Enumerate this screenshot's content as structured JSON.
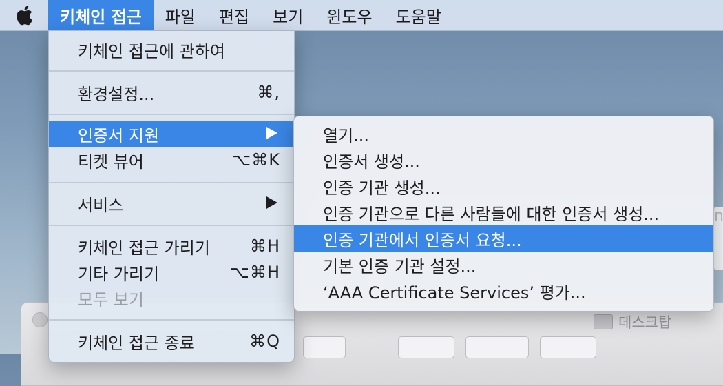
{
  "menubar": {
    "apple_icon": "apple-icon",
    "items": [
      {
        "label": "키체인 접근"
      },
      {
        "label": "파일"
      },
      {
        "label": "편집"
      },
      {
        "label": "보기"
      },
      {
        "label": "윈도우"
      },
      {
        "label": "도움말"
      }
    ]
  },
  "app_menu": {
    "items": [
      {
        "label": "키체인 접근에 관하여",
        "shortcut": ""
      },
      {
        "label": "환경설정...",
        "shortcut": "⌘,"
      },
      {
        "label": "인증서 지원",
        "shortcut": "",
        "submenu_icon": "submenu-arrow-icon"
      },
      {
        "label": "티켓 뷰어",
        "shortcut": "⌥⌘K"
      },
      {
        "label": "서비스",
        "shortcut": "",
        "submenu_icon": "submenu-arrow-icon"
      },
      {
        "label": "키체인 접근 가리기",
        "shortcut": "⌘H"
      },
      {
        "label": "기타 가리기",
        "shortcut": "⌥⌘H"
      },
      {
        "label": "모두 보기",
        "shortcut": ""
      },
      {
        "label": "키체인 접근 종료",
        "shortcut": "⌘Q"
      }
    ]
  },
  "certificate_submenu": {
    "items": [
      {
        "label": "열기..."
      },
      {
        "label": "인증서 생성..."
      },
      {
        "label": "인증 기관 생성..."
      },
      {
        "label": "인증 기관으로 다른 사람들에 대한 인증서 생성..."
      },
      {
        "label": "인증 기관에서 인증서 요청..."
      },
      {
        "label": "기본 인증 기관 설정..."
      },
      {
        "label": "‘AAA Certificate Services’ 평가..."
      }
    ]
  },
  "background": {
    "desktop_label": "데스크탑",
    "right_strip_text": "ng"
  },
  "colors": {
    "highlight": "#3a86e6",
    "menubar": "#d6e2f0",
    "disabled_text": "#9a9ea6"
  }
}
